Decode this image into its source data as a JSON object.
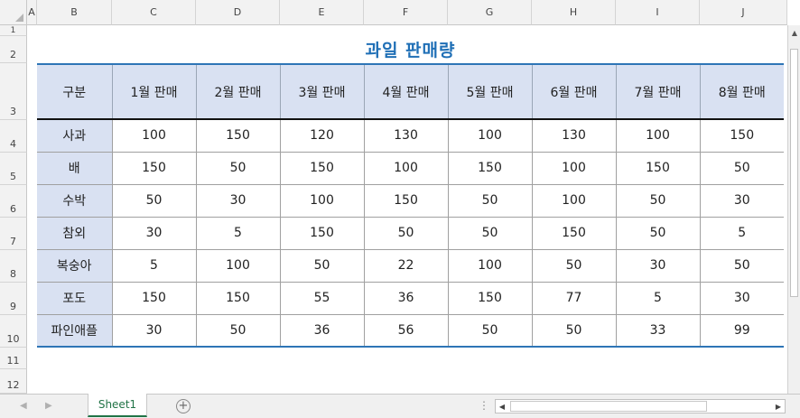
{
  "columns": [
    "A",
    "B",
    "C",
    "D",
    "E",
    "F",
    "G",
    "H",
    "I",
    "J"
  ],
  "rows": [
    "1",
    "2",
    "3",
    "4",
    "5",
    "6",
    "7",
    "8",
    "9",
    "10",
    "11",
    "12"
  ],
  "title": "과일 판매량",
  "table": {
    "headers": [
      "구분",
      "1월 판매",
      "2월 판매",
      "3월 판매",
      "4월 판매",
      "5월 판매",
      "6월 판매",
      "7월 판매",
      "8월 판매"
    ],
    "rows": [
      {
        "label": "사과",
        "values": [
          "100",
          "150",
          "120",
          "130",
          "100",
          "130",
          "100",
          "150"
        ]
      },
      {
        "label": "배",
        "values": [
          "150",
          "50",
          "150",
          "100",
          "150",
          "100",
          "150",
          "50"
        ]
      },
      {
        "label": "수박",
        "values": [
          "50",
          "30",
          "100",
          "150",
          "50",
          "100",
          "50",
          "30"
        ]
      },
      {
        "label": "참외",
        "values": [
          "30",
          "5",
          "150",
          "50",
          "50",
          "150",
          "50",
          "5"
        ]
      },
      {
        "label": "복숭아",
        "values": [
          "5",
          "100",
          "50",
          "22",
          "100",
          "50",
          "30",
          "50"
        ]
      },
      {
        "label": "포도",
        "values": [
          "150",
          "150",
          "55",
          "36",
          "150",
          "77",
          "5",
          "30"
        ]
      },
      {
        "label": "파인애플",
        "values": [
          "30",
          "50",
          "36",
          "56",
          "50",
          "50",
          "33",
          "99"
        ]
      }
    ]
  },
  "sheet_tab": "Sheet1",
  "add_sheet_symbol": "+",
  "scroll_dots": "⋮",
  "colors": {
    "title": "#1f6fb6",
    "header_fill": "#d9e1f2",
    "accent_border": "#2e75b6",
    "sheet_tab_text": "#217346"
  }
}
